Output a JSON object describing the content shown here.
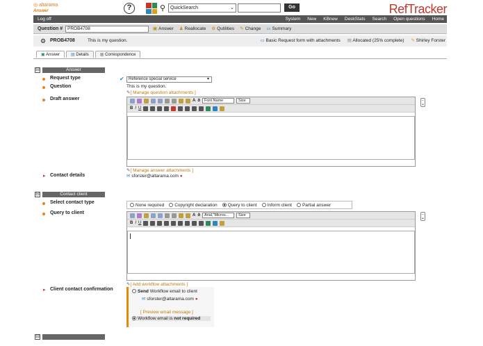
{
  "header": {
    "logo_text": "altarama",
    "logo_sub": "Answer",
    "quicksearch_value": "QuickSearch",
    "go_label": "Go",
    "brand": "RefTracker"
  },
  "topbar": {
    "left": "Log off",
    "links": [
      "System",
      "New",
      "KBnew",
      "DeskStats",
      "Search",
      "Open questions",
      "Home"
    ]
  },
  "question_bar": {
    "label": "Question #",
    "number": "PROB4708",
    "tools": [
      "Answer",
      "Reallocate",
      "Qutilities",
      "Change",
      "Summary"
    ]
  },
  "info_bar": {
    "prob": "PROB4708",
    "desc": "This is my question.",
    "form": "Basic Request form with attachments",
    "status": "Allocated (25% complete)",
    "user": "Shirley Forster"
  },
  "tabs": [
    "Answer",
    "Details",
    "Correspondence"
  ],
  "answer_section": {
    "title": "Answer",
    "request_type_label": "Request type",
    "request_type_value": "Reference special service",
    "question_label": "Question",
    "question_value": "This is my question.",
    "manage_question_attachments": "[ Manage question attachments ]",
    "draft_label": "Draft answer",
    "manage_answer_attachments": "[ Manage answer attachments ]",
    "contact_label": "Contact details",
    "contact_email": "sforster@altarama.com"
  },
  "editor": {
    "font_name": "Font Name",
    "size": "Size",
    "font_name2": "Arial,\"Micros...",
    "size2": "Size"
  },
  "contact_section": {
    "title": "Contact client",
    "select_type_label": "Select contact type",
    "options": [
      "None required",
      "Copyright declaration",
      "Query to client",
      "Inform client",
      "Partial answer"
    ],
    "selected": "Query to client",
    "query_label": "Query to client",
    "add_workflow_attachments": "[ Add workflow attachments ]",
    "confirmation_label": "Client contact confirmation",
    "send_bold": "Send",
    "send_rest": "Workflow email to client",
    "email": "sforster@altarama.com",
    "preview": "[ Preview email message ]",
    "not_required_pre": "Workflow email is",
    "not_required_bold": "not required"
  }
}
